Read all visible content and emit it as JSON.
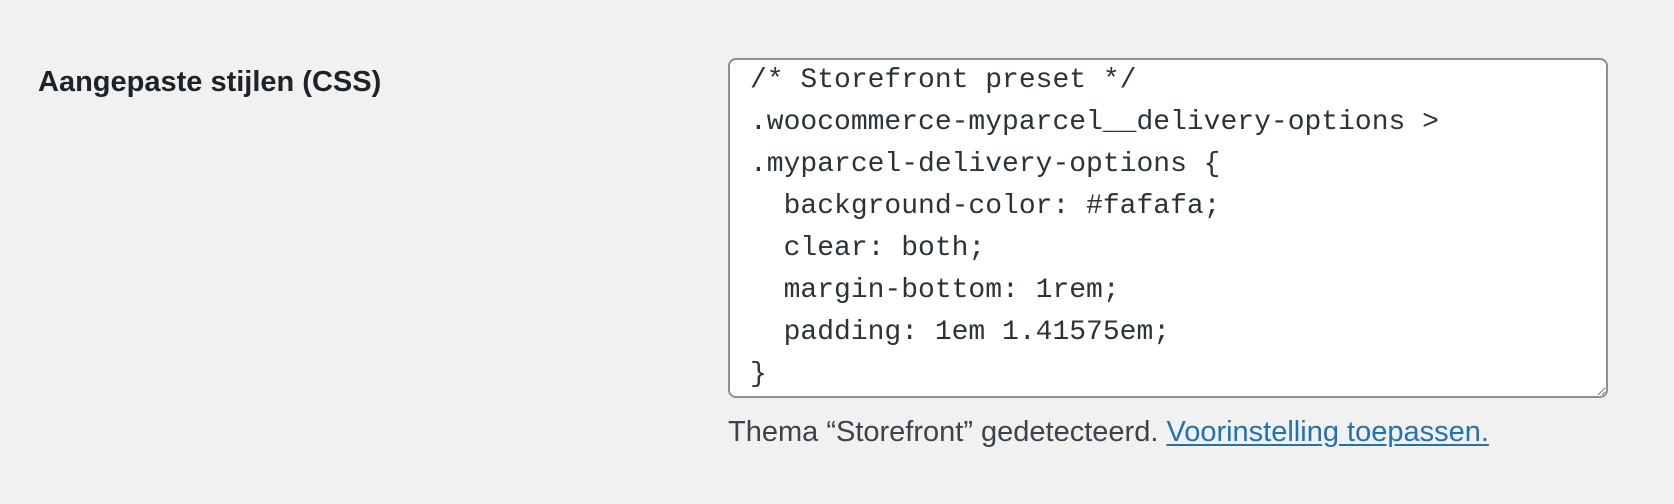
{
  "setting": {
    "label": "Aangepaste stijlen (CSS)",
    "css_value": "/* Storefront preset */\n.woocommerce-myparcel__delivery-options >\n.myparcel-delivery-options {\n  background-color: #fafafa;\n  clear: both;\n  margin-bottom: 1rem;\n  padding: 1em 1.41575em;\n}",
    "description_text": "Thema “Storefront” gedetecteerd.",
    "preset_link_label": "Voorinstelling toepassen."
  },
  "colors": {
    "page_background": "#f1f1f1",
    "textarea_border": "#8c8f94",
    "link": "#2271b1"
  }
}
